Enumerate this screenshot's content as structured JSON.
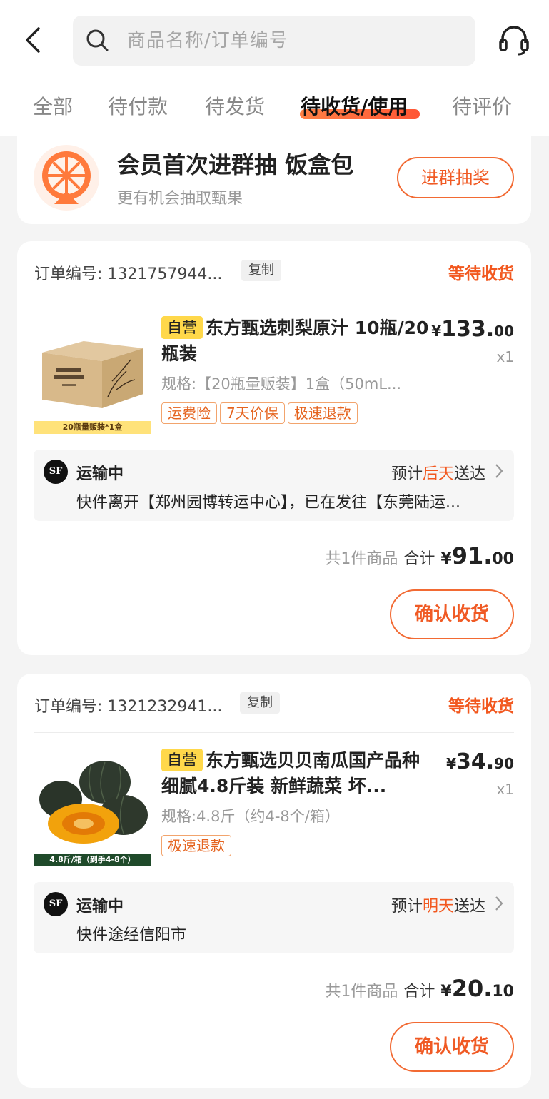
{
  "header": {
    "search_placeholder": "商品名称/订单编号"
  },
  "tabs": [
    {
      "label": "全部",
      "active": false
    },
    {
      "label": "待付款",
      "active": false
    },
    {
      "label": "待发货",
      "active": false
    },
    {
      "label": "待收货/使用",
      "active": true
    },
    {
      "label": "待评价",
      "active": false
    }
  ],
  "promo": {
    "title": "会员首次进群抽 饭盒包",
    "subtitle": "更有机会抽取甄果",
    "button": "进群抽奖"
  },
  "orders": [
    {
      "order_no": "订单编号: 1321757944...",
      "copy": "复制",
      "status": "等待收货",
      "product": {
        "self_tag": "自营",
        "title": "东方甄选刺梨原汁 10瓶/20瓶装",
        "thumb_band": "20瓶量贩装*1盒",
        "spec": "规格:【20瓶量贩装】1盒（50mL...",
        "tags": [
          "运费险",
          "7天价保",
          "极速退款"
        ],
        "price_currency": "¥",
        "price_int": "133.",
        "price_dec": "00",
        "qty": "x1"
      },
      "shipping": {
        "carrier": "SF",
        "status": "运输中",
        "eta_prefix": "预计",
        "eta_day": "后天",
        "eta_suffix": "送达",
        "track": "快件离开【郑州园博转运中心】，已在发往【东莞陆运..."
      },
      "total": {
        "count": "共1件商品",
        "label": "合计",
        "currency": "¥",
        "int": "91.",
        "dec": "00"
      },
      "confirm": "确认收货"
    },
    {
      "order_no": "订单编号: 1321232941...",
      "copy": "复制",
      "status": "等待收货",
      "product": {
        "self_tag": "自营",
        "title": "东方甄选贝贝南瓜国产品种细腻4.8斤装 新鲜蔬菜 坏...",
        "thumb_band": "4.8斤/箱（到手4-8个）",
        "spec": "规格:4.8斤（约4-8个/箱）",
        "tags": [
          "极速退款"
        ],
        "price_currency": "¥",
        "price_int": "34.",
        "price_dec": "90",
        "qty": "x1"
      },
      "shipping": {
        "carrier": "SF",
        "status": "运输中",
        "eta_prefix": "预计",
        "eta_day": "明天",
        "eta_suffix": "送达",
        "track": "快件途经信阳市"
      },
      "total": {
        "count": "共1件商品",
        "label": "合计",
        "currency": "¥",
        "int": "20.",
        "dec": "10"
      },
      "confirm": "确认收货"
    }
  ],
  "colors": {
    "accent": "#f2581f",
    "self_tag": "#ffd84a"
  }
}
